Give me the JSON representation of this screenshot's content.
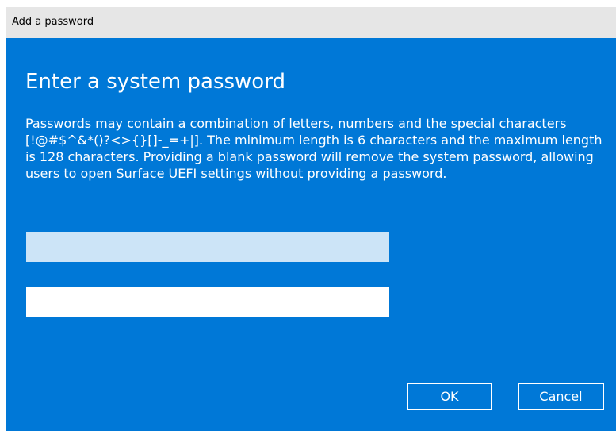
{
  "window": {
    "title": "Add a password"
  },
  "dialog": {
    "heading": "Enter a system password",
    "description": "Passwords may contain a combination of letters, numbers and the special characters [!@#$^&*()?<>{}[]-_=+|]. The minimum length is 6 characters and the maximum length is 128 characters. Providing a blank password will remove the system password, allowing users to open Surface UEFI settings without providing a password.",
    "password_field": {
      "value": "",
      "placeholder": ""
    },
    "confirm_password_field": {
      "value": "",
      "placeholder": ""
    },
    "buttons": {
      "ok_label": "OK",
      "cancel_label": "Cancel"
    }
  },
  "colors": {
    "accent_blue": "#0078d7",
    "focused_input": "#cce4f7",
    "titlebar": "#e6e6e6"
  }
}
